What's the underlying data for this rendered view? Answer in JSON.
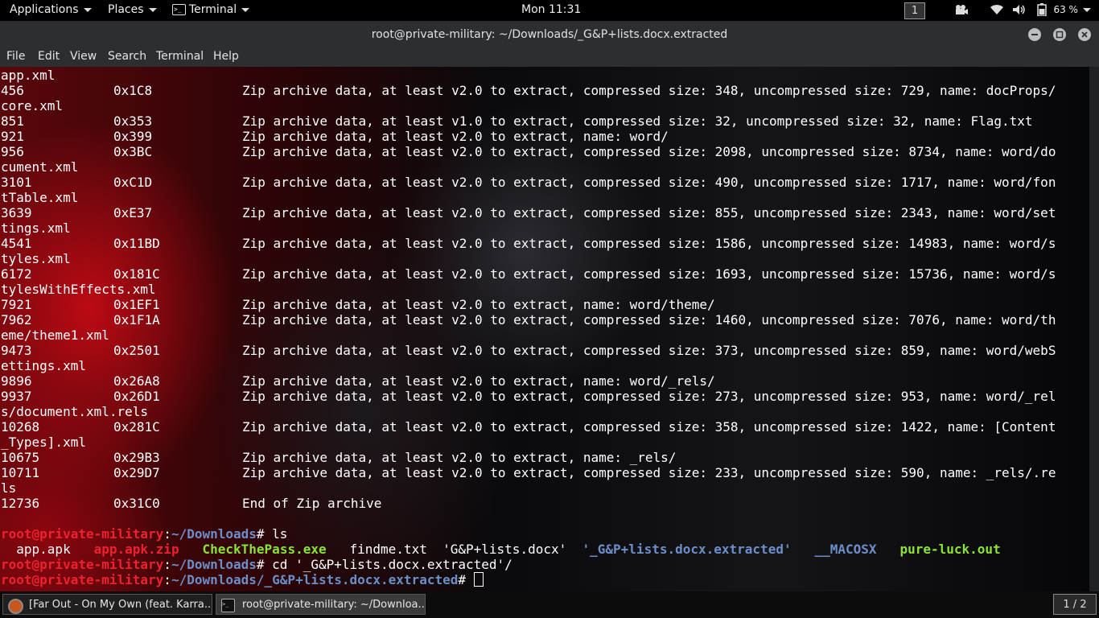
{
  "topbar": {
    "applications": "Applications",
    "places": "Places",
    "terminal": "Terminal",
    "clock": "Mon 11:31",
    "workspace": "1",
    "battery": "63 %"
  },
  "window": {
    "title": "root@private-military: ~/Downloads/_G&P+lists.docx.extracted"
  },
  "menu": [
    "File",
    "Edit",
    "View",
    "Search",
    "Terminal",
    "Help"
  ],
  "terminal": {
    "rows": [
      [
        "app.xml",
        "",
        ""
      ],
      [
        "456",
        "0x1C8",
        "Zip archive data, at least v2.0 to extract, compressed size: 348, uncompressed size: 729, name: docProps/"
      ],
      [
        "core.xml",
        "",
        ""
      ],
      [
        "851",
        "0x353",
        "Zip archive data, at least v1.0 to extract, compressed size: 32, uncompressed size: 32, name: Flag.txt"
      ],
      [
        "921",
        "0x399",
        "Zip archive data, at least v2.0 to extract, name: word/"
      ],
      [
        "956",
        "0x3BC",
        "Zip archive data, at least v2.0 to extract, compressed size: 2098, uncompressed size: 8734, name: word/do"
      ],
      [
        "cument.xml",
        "",
        ""
      ],
      [
        "3101",
        "0xC1D",
        "Zip archive data, at least v2.0 to extract, compressed size: 490, uncompressed size: 1717, name: word/fon"
      ],
      [
        "tTable.xml",
        "",
        ""
      ],
      [
        "3639",
        "0xE37",
        "Zip archive data, at least v2.0 to extract, compressed size: 855, uncompressed size: 2343, name: word/set"
      ],
      [
        "tings.xml",
        "",
        ""
      ],
      [
        "4541",
        "0x11BD",
        "Zip archive data, at least v2.0 to extract, compressed size: 1586, uncompressed size: 14983, name: word/s"
      ],
      [
        "tyles.xml",
        "",
        ""
      ],
      [
        "6172",
        "0x181C",
        "Zip archive data, at least v2.0 to extract, compressed size: 1693, uncompressed size: 15736, name: word/s"
      ],
      [
        "tylesWithEffects.xml",
        "",
        ""
      ],
      [
        "7921",
        "0x1EF1",
        "Zip archive data, at least v2.0 to extract, name: word/theme/"
      ],
      [
        "7962",
        "0x1F1A",
        "Zip archive data, at least v2.0 to extract, compressed size: 1460, uncompressed size: 7076, name: word/th"
      ],
      [
        "eme/theme1.xml",
        "",
        ""
      ],
      [
        "9473",
        "0x2501",
        "Zip archive data, at least v2.0 to extract, compressed size: 373, uncompressed size: 859, name: word/webS"
      ],
      [
        "ettings.xml",
        "",
        ""
      ],
      [
        "9896",
        "0x26A8",
        "Zip archive data, at least v2.0 to extract, name: word/_rels/"
      ],
      [
        "9937",
        "0x26D1",
        "Zip archive data, at least v2.0 to extract, compressed size: 273, uncompressed size: 953, name: word/_rel"
      ],
      [
        "s/document.xml.rels",
        "",
        ""
      ],
      [
        "10268",
        "0x281C",
        "Zip archive data, at least v2.0 to extract, compressed size: 358, uncompressed size: 1422, name: [Content"
      ],
      [
        "_Types].xml",
        "",
        ""
      ],
      [
        "10675",
        "0x29B3",
        "Zip archive data, at least v2.0 to extract, name: _rels/"
      ],
      [
        "10711",
        "0x29D7",
        "Zip archive data, at least v2.0 to extract, compressed size: 233, uncompressed size: 590, name: _rels/.re"
      ],
      [
        "ls",
        "",
        ""
      ],
      [
        "12736",
        "0x31C0",
        "End of Zip archive"
      ]
    ],
    "prompt1": {
      "user": "root@private-military",
      "sep": ":",
      "path": "~/Downloads",
      "cmd": "# ls"
    },
    "ls_output": [
      {
        "name": "app.apk",
        "color": "#ffffff",
        "bold": false
      },
      {
        "name": "app.apk.zip",
        "color": "#ed2130",
        "bold": true
      },
      {
        "name": "CheckThePass.exe",
        "color": "#8ae234",
        "bold": true
      },
      {
        "name": "findme.txt",
        "color": "#ffffff",
        "bold": false
      },
      {
        "name": "'G&P+lists.docx'",
        "color": "#ffffff",
        "bold": false
      },
      {
        "name": "'_G&P+lists.docx.extracted'",
        "color": "#6c8ec9",
        "bold": true
      },
      {
        "name": "__MACOSX",
        "color": "#6c8ec9",
        "bold": true
      },
      {
        "name": "pure-luck.out",
        "color": "#8ae234",
        "bold": true
      }
    ],
    "prompt2": {
      "user": "root@private-military",
      "sep": ":",
      "path": "~/Downloads",
      "cmd": "# cd '_G&P+lists.docx.extracted'/"
    },
    "prompt3": {
      "user": "root@private-military",
      "sep": ":",
      "path": "~/Downloads/_G&P+lists.docx.extracted",
      "cmd": "# "
    }
  },
  "taskbar": {
    "task1": "[Far Out - On My Own (feat. Karra...",
    "task2": "root@private-military: ~/Downloa...",
    "pager": "1 / 2"
  },
  "colors": {
    "prompt_user": "#ed2130",
    "prompt_path": "#6c8ec9",
    "executable": "#8ae234"
  }
}
